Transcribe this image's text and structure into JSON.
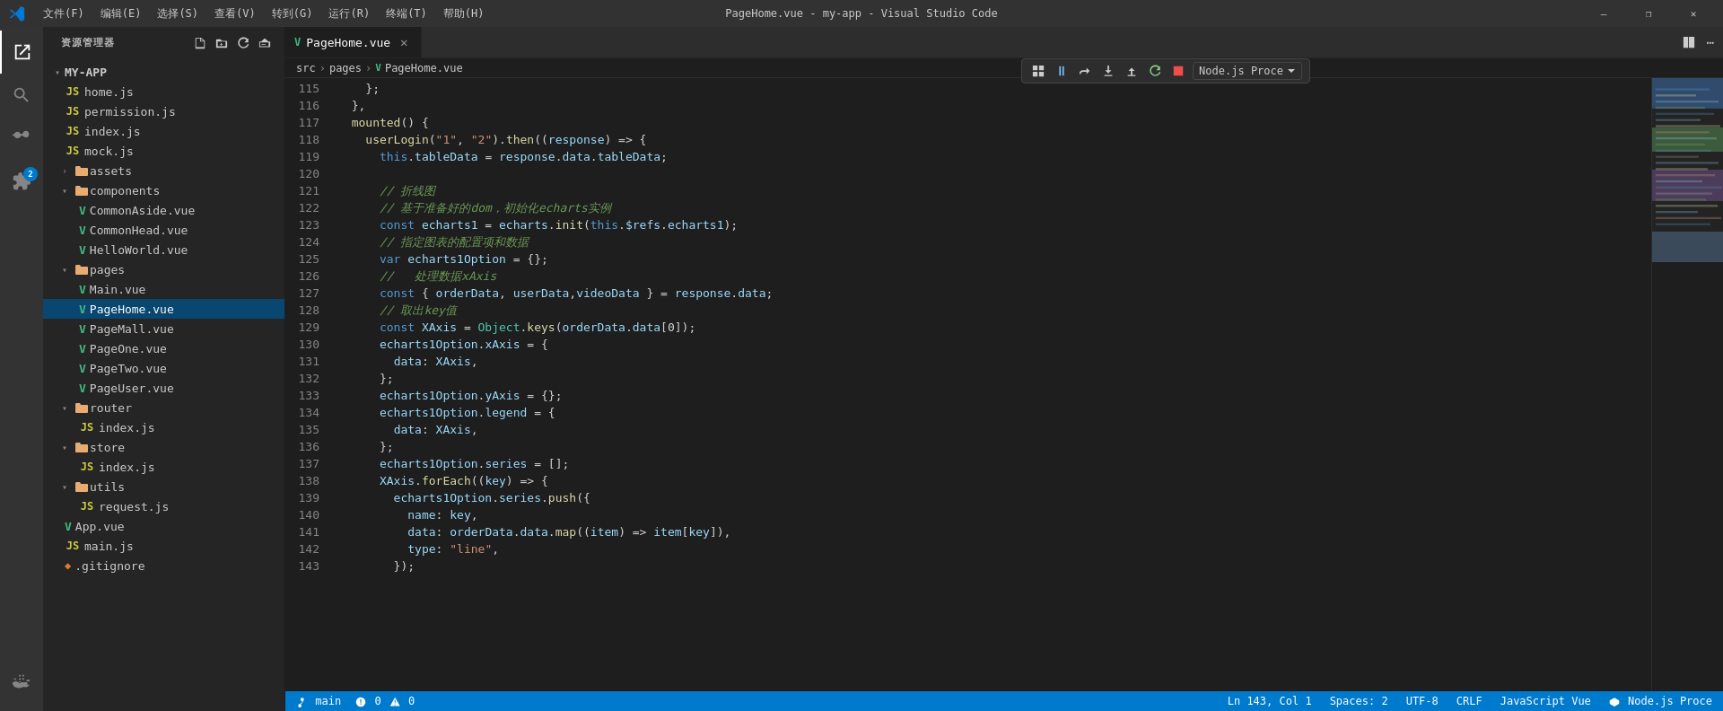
{
  "titleBar": {
    "title": "PageHome.vue - my-app - Visual Studio Code",
    "menus": [
      "文件(F)",
      "编辑(E)",
      "选择(S)",
      "查看(V)",
      "转到(G)",
      "运行(R)",
      "终端(T)",
      "帮助(H)"
    ],
    "windowButtons": [
      "—",
      "❐",
      "✕"
    ]
  },
  "sidebar": {
    "header": "资源管理器",
    "rootLabel": "MY-APP",
    "actions": [
      "new-file",
      "new-folder",
      "refresh",
      "collapse"
    ]
  },
  "fileTree": {
    "items": [
      {
        "id": "home.js",
        "name": "home.js",
        "type": "js",
        "indent": 1
      },
      {
        "id": "permission.js",
        "name": "permission.js",
        "type": "js",
        "indent": 1
      },
      {
        "id": "index.js",
        "name": "index.js",
        "type": "js",
        "indent": 1
      },
      {
        "id": "mock.js",
        "name": "mock.js",
        "type": "js",
        "indent": 1
      },
      {
        "id": "assets",
        "name": "assets",
        "type": "folder",
        "indent": 1
      },
      {
        "id": "components",
        "name": "components",
        "type": "folder",
        "indent": 1
      },
      {
        "id": "CommonAside.vue",
        "name": "CommonAside.vue",
        "type": "vue",
        "indent": 2
      },
      {
        "id": "CommonHead.vue",
        "name": "CommonHead.vue",
        "type": "vue",
        "indent": 2
      },
      {
        "id": "HelloWorld.vue",
        "name": "HelloWorld.vue",
        "type": "vue",
        "indent": 2
      },
      {
        "id": "pages",
        "name": "pages",
        "type": "folder",
        "indent": 1
      },
      {
        "id": "Main.vue",
        "name": "Main.vue",
        "type": "vue",
        "indent": 2
      },
      {
        "id": "PageHome.vue",
        "name": "PageHome.vue",
        "type": "vue",
        "indent": 2,
        "selected": true
      },
      {
        "id": "PageMall.vue",
        "name": "PageMall.vue",
        "type": "vue",
        "indent": 2
      },
      {
        "id": "PageOne.vue",
        "name": "PageOne.vue",
        "type": "vue",
        "indent": 2
      },
      {
        "id": "PageTwo.vue",
        "name": "PageTwo.vue",
        "type": "vue",
        "indent": 2
      },
      {
        "id": "PageUser.vue",
        "name": "PageUser.vue",
        "type": "vue",
        "indent": 2
      },
      {
        "id": "router",
        "name": "router",
        "type": "folder",
        "indent": 1
      },
      {
        "id": "router-index.js",
        "name": "index.js",
        "type": "js",
        "indent": 2
      },
      {
        "id": "store",
        "name": "store",
        "type": "folder",
        "indent": 1
      },
      {
        "id": "store-index.js",
        "name": "index.js",
        "type": "js",
        "indent": 2
      },
      {
        "id": "utils",
        "name": "utils",
        "type": "folder",
        "indent": 1
      },
      {
        "id": "request.js",
        "name": "request.js",
        "type": "js",
        "indent": 2
      },
      {
        "id": "App.vue",
        "name": "App.vue",
        "type": "vue",
        "indent": 1
      },
      {
        "id": "main.js",
        "name": "main.js",
        "type": "js",
        "indent": 1
      },
      {
        "id": ".gitignore",
        "name": ".gitignore",
        "type": "git",
        "indent": 1
      }
    ]
  },
  "tabs": [
    {
      "id": "pagehome",
      "label": "PageHome.vue",
      "active": true,
      "modified": false
    }
  ],
  "breadcrumb": {
    "parts": [
      "src",
      "pages",
      "PageHome.vue"
    ]
  },
  "codeLines": [
    {
      "num": 115,
      "content": "    };"
    },
    {
      "num": 116,
      "content": "  },"
    },
    {
      "num": 117,
      "content": "  mounted() {"
    },
    {
      "num": 118,
      "content": "    userLogin(\"1\", \"2\").then((response) => {"
    },
    {
      "num": 119,
      "content": "      this.tableData = response.data.tableData;"
    },
    {
      "num": 120,
      "content": ""
    },
    {
      "num": 121,
      "content": "      // 折线图"
    },
    {
      "num": 122,
      "content": "      // 基于准备好的dom，初始化echarts实例"
    },
    {
      "num": 123,
      "content": "      const echarts1 = echarts.init(this.$refs.echarts1);"
    },
    {
      "num": 124,
      "content": "      // 指定图表的配置项和数据"
    },
    {
      "num": 125,
      "content": "      var echarts1Option = {};"
    },
    {
      "num": 126,
      "content": "      //   处理数据xAxis"
    },
    {
      "num": 127,
      "content": "      const { orderData, userData,videoData } = response.data;"
    },
    {
      "num": 128,
      "content": "      // 取出key值"
    },
    {
      "num": 129,
      "content": "      const XAxis = Object.keys(orderData.data[0]);"
    },
    {
      "num": 130,
      "content": "      echarts1Option.xAxis = {"
    },
    {
      "num": 131,
      "content": "        data: XAxis,"
    },
    {
      "num": 132,
      "content": "      };"
    },
    {
      "num": 133,
      "content": "      echarts1Option.yAxis = {};"
    },
    {
      "num": 134,
      "content": "      echarts1Option.legend = {"
    },
    {
      "num": 135,
      "content": "        data: XAxis,"
    },
    {
      "num": 136,
      "content": "      };"
    },
    {
      "num": 137,
      "content": "      echarts1Option.series = [];"
    },
    {
      "num": 138,
      "content": "      XAxis.forEach((key) => {"
    },
    {
      "num": 139,
      "content": "        echarts1Option.series.push({"
    },
    {
      "num": 140,
      "content": "          name: key,"
    },
    {
      "num": 141,
      "content": "          data: orderData.data.map((item) => item[key]),"
    },
    {
      "num": 142,
      "content": "          type: \"line\","
    },
    {
      "num": 143,
      "content": "        });"
    }
  ],
  "debugToolbar": {
    "label": "Node.js Proce",
    "buttons": [
      "grid",
      "pause",
      "step-over",
      "step-into",
      "step-out",
      "restart",
      "stop"
    ]
  },
  "statusBar": {
    "left": [
      "⎇ main",
      "⚠ 0",
      "✗ 0"
    ],
    "right": [
      "Ln 143, Col 1",
      "Spaces: 2",
      "UTF-8",
      "CRLF",
      "JavaScript Vue",
      "Node.js Proce"
    ]
  }
}
